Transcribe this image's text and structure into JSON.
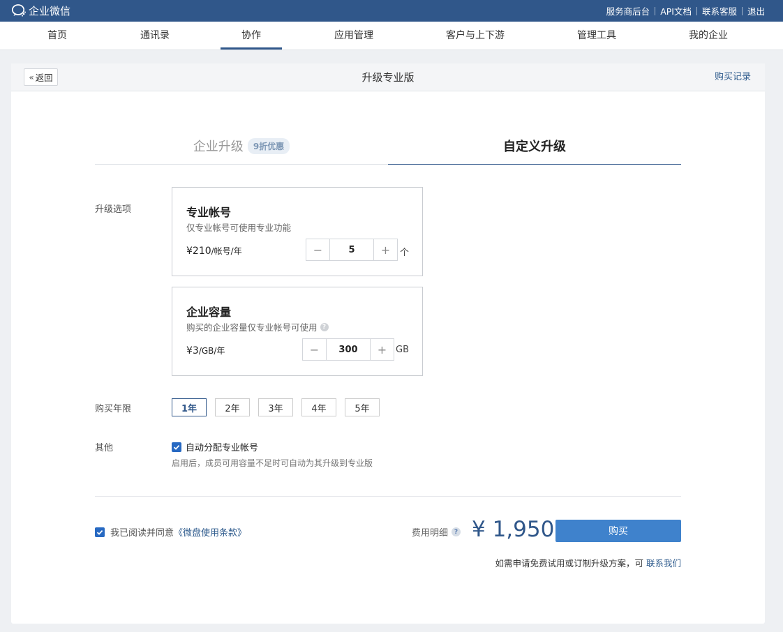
{
  "topbar": {
    "logo_text": "企业微信",
    "links": [
      "服务商后台",
      "API文档",
      "联系客服",
      "退出"
    ]
  },
  "nav": {
    "items": [
      "首页",
      "通讯录",
      "协作",
      "应用管理",
      "客户与上下游",
      "管理工具",
      "我的企业"
    ],
    "active_index": 2
  },
  "card": {
    "back_label": "返回",
    "title": "升级专业版",
    "buy_record_label": "购买记录"
  },
  "tabs": {
    "enterprise_upgrade": "企业升级",
    "discount_badge": "9折优惠",
    "custom_upgrade": "自定义升级"
  },
  "upgrade_options": {
    "label": "升级选项",
    "pro_account": {
      "title": "专业帐号",
      "desc": "仅专业帐号可使用专业功能",
      "price": "¥210",
      "price_unit": "/帐号/年",
      "quantity": "5",
      "unit": "个"
    },
    "storage": {
      "title": "企业容量",
      "desc": "购买的企业容量仅专业帐号可使用",
      "price": "¥3",
      "price_unit": "/GB/年",
      "quantity": "300",
      "unit": "GB"
    }
  },
  "period": {
    "label": "购买年限",
    "options": [
      "1年",
      "2年",
      "3年",
      "4年",
      "5年"
    ],
    "selected_index": 0
  },
  "other": {
    "label": "其他",
    "auto_assign_label": "自动分配专业帐号",
    "auto_assign_checked": true,
    "auto_assign_desc": "启用后，成员可用容量不足时可自动为其升级到专业版"
  },
  "footer": {
    "agree_prefix": "我已阅读并同意",
    "terms_link": "《微盘使用条款》",
    "agree_checked": true,
    "fee_label": "费用明细",
    "total": "¥ 1,950",
    "buy_label": "购买",
    "contact_prefix": "如需申请免费试用或订制升级方案，可",
    "contact_link": "联系我们"
  },
  "colors": {
    "brand": "#30578a",
    "button": "#3f82cc",
    "checkbox": "#2769c2"
  }
}
